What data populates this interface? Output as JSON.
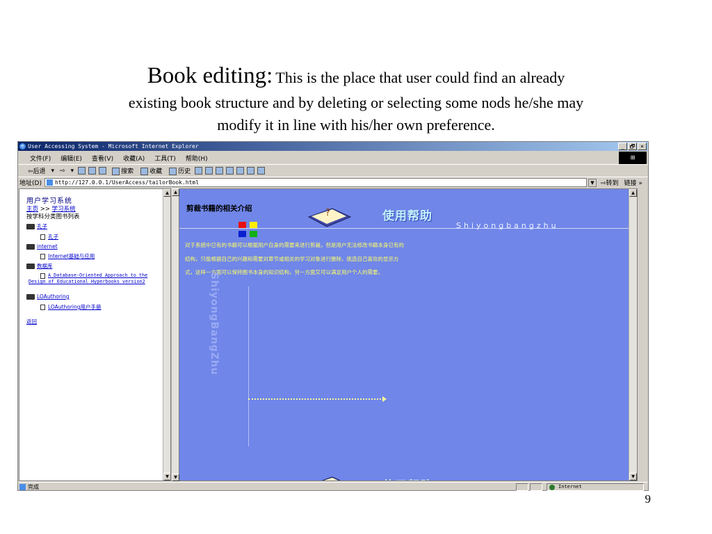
{
  "slide": {
    "title_head": "Book editing:",
    "title_line1": "This is the place that user could find an already",
    "title_line2": "existing book structure and by deleting or selecting some nods he/she may",
    "title_line3": "modify it in line with his/her own preference.",
    "page_number": "9"
  },
  "browser": {
    "window_title": "User Accessing System - Microsoft Internet Explorer",
    "window_buttons": [
      "_",
      "🗗",
      "×"
    ],
    "menu": [
      "文件(F)",
      "编辑(E)",
      "查看(V)",
      "收藏(A)",
      "工具(T)",
      "帮助(H)"
    ],
    "toolbar": {
      "back": "⇦后退",
      "forward": "⇨",
      "search": "搜索",
      "favorites": "收藏",
      "history": "历史"
    },
    "address_label": "地址(D)",
    "address_value": "http://127.0.0.1/UserAccess/tailorBook.html",
    "go_label": "转到",
    "links_label": "链接",
    "status_text": "完成",
    "status_zone": "Internet"
  },
  "left_frame": {
    "title": "用户学习系统",
    "breadcrumb_home": "主页",
    "breadcrumb_sep": ">>",
    "breadcrumb_system": "学习系统",
    "subtitle": "按学科分类图书列表",
    "tree": [
      {
        "type": "folder",
        "label": "孔子"
      },
      {
        "type": "leaf",
        "label": "孔子"
      },
      {
        "type": "folder",
        "label": "internet"
      },
      {
        "type": "leaf",
        "label": "Internet基础与应用"
      },
      {
        "type": "folder",
        "label": "数据库"
      },
      {
        "type": "leaf",
        "label": "A Database-Oriented Approach to the Design of Educational Hyperbooks version2"
      },
      {
        "type": "folder",
        "label": "LOAuthoring"
      },
      {
        "type": "leaf",
        "label": "LOAuthoring用户手册"
      }
    ],
    "back_link": "返回"
  },
  "right_frame": {
    "title": "剪裁书籍的相关介绍",
    "help_title": "使用帮助",
    "help_pinyin": "Shiyongbangzhu",
    "description": "对于系统中已有的书籍可以根据用户自身的需要来进行剪裁，但是用户无法修改书籍本身已有的结构，只能根据自己的兴趣和需要对章节或相关的学习对象进行删除，挑选自己喜欢的显示方式，这样一方面可以保持图书本身的知识结构，另一方面又可以满足用户个人的需要。",
    "watermark": "ShiyongBangZhu",
    "colors": {
      "background": "#7086e8",
      "description_text": "#ffff66",
      "help_title": "#c4f3fd"
    }
  }
}
